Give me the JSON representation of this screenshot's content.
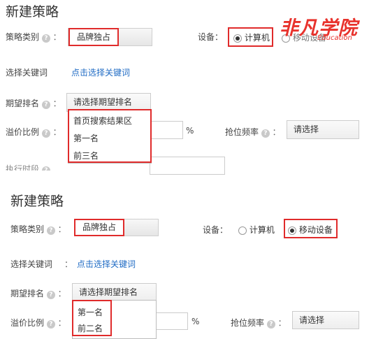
{
  "section1": {
    "title": "新建策略",
    "category_label": "策略类别",
    "category_value": "品牌独占",
    "device_label": "设备：",
    "device_opt1": "计算机",
    "device_opt2": "移动设备",
    "keyword_label": "选择关键词",
    "keyword_link": "点击选择关键词",
    "rank_label": "期望排名",
    "rank_placeholder": "请选择期望排名",
    "rank_options": [
      "首页搜索结果区",
      "第一名",
      "前三名"
    ],
    "premium_label": "溢价比例",
    "premium_unit": "%",
    "freq_label": "抢位频率",
    "freq_value": "请选择",
    "partial_label": "执行时段"
  },
  "section2": {
    "title": "新建策略",
    "category_label": "策略类别",
    "category_value": "品牌独占",
    "device_label": "设备：",
    "device_opt1": "计算机",
    "device_opt2": "移动设备",
    "keyword_label": "选择关键词",
    "keyword_link": "点击选择关键词",
    "rank_label": "期望排名",
    "rank_placeholder": "请选择期望排名",
    "rank_options": [
      "第一名",
      "前二名"
    ],
    "premium_label": "溢价比例",
    "premium_unit": "%",
    "freq_label": "抢位频率",
    "freq_value": "请选择"
  },
  "help_glyph": "?",
  "colon": "：",
  "watermark": {
    "brand": "非凡学院",
    "sub": "Education"
  },
  "colors": {
    "highlight": "#e02b2b",
    "link": "#1f6bc4",
    "watermark": "#e8322c"
  }
}
